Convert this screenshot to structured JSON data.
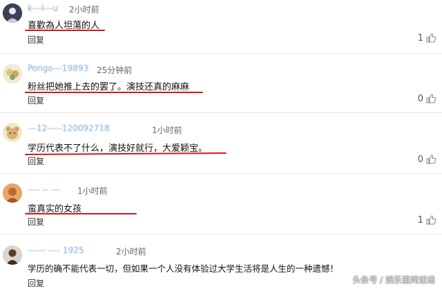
{
  "reply_label": "回复",
  "comments": [
    {
      "username": "k---I---u",
      "time": "2小时前",
      "text": "喜歡為人坦蕩的人",
      "likes": "1",
      "avatar": "dark-profile-avatar"
    },
    {
      "username": "Pongo---19893",
      "time": "25分钟前",
      "text": "粉丝把她推上去的罢了。演技还真的麻麻",
      "likes": "0",
      "avatar": "flower-avatar"
    },
    {
      "username": "---12-----120092718",
      "time": "1小时前",
      "text": "学历代表不了什么，演技好就行，大爱颖宝。",
      "likes": "0",
      "avatar": "bear-avatar"
    },
    {
      "username": "---- -- ---",
      "time": "1小时前",
      "text": "蛮真实的女孩",
      "likes": "1",
      "avatar": "orange-avatar"
    },
    {
      "username": "------ ---- 1925",
      "time": "2小时前",
      "text": "学历的确不能代表一切，但如果一个人没有体验过大学生活将是人生的一种遗憾！",
      "likes": "",
      "avatar": "portrait-avatar"
    }
  ],
  "watermark": "头条号 / 娱乐重闻速递",
  "colors": {
    "underline": "#d9141c",
    "username": "#7ea9d8"
  }
}
